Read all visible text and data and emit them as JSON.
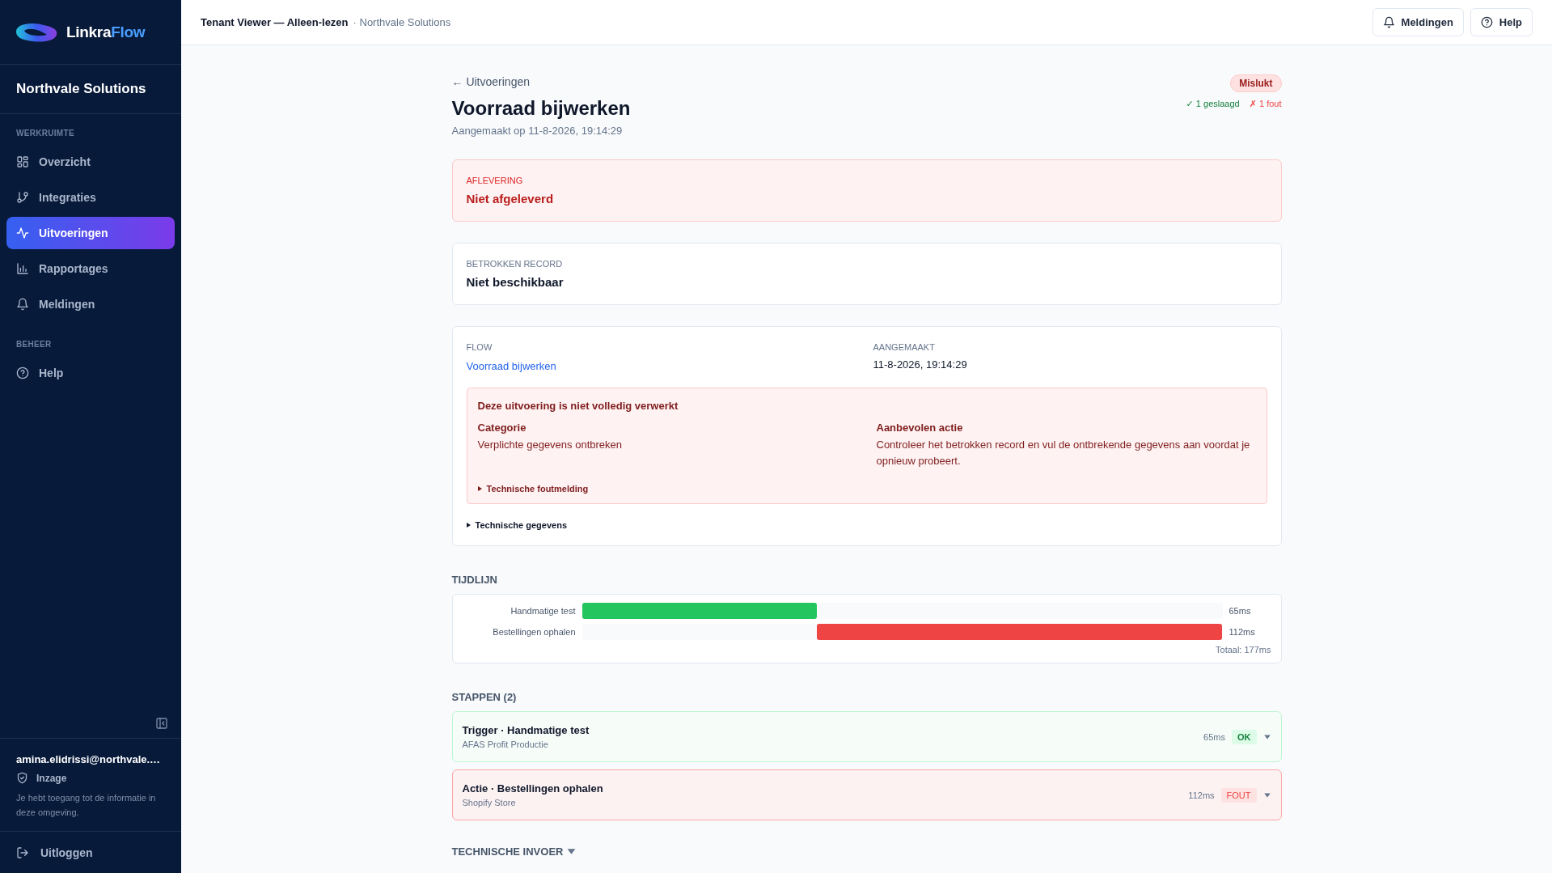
{
  "sidebar": {
    "logo": {
      "part1": "Linkra",
      "part2": "Flow"
    },
    "tenant": "Northvale Solutions",
    "sections": [
      {
        "title": "WERKRUIMTE",
        "items": [
          {
            "label": "Overzicht",
            "selected": false
          },
          {
            "label": "Integraties",
            "selected": false
          },
          {
            "label": "Uitvoeringen",
            "selected": true
          },
          {
            "label": "Rapportages",
            "selected": false
          },
          {
            "label": "Meldingen",
            "selected": false
          }
        ]
      },
      {
        "title": "BEHEER",
        "items": [
          {
            "label": "Help",
            "selected": false
          }
        ]
      }
    ],
    "user": {
      "email": "amina.elidrissi@northvale.…",
      "role": "Inzage",
      "description": "Je hebt toegang tot de informatie in deze omgeving."
    },
    "logout": "Uitloggen"
  },
  "topbar": {
    "title": "Tenant Viewer — Alleen-lezen",
    "subtitle": "· Northvale Solutions",
    "buttons": [
      "Meldingen",
      "Help"
    ]
  },
  "header": {
    "back": "← Uitvoeringen",
    "title": "Voorraad bijwerken",
    "created": "Aangemaakt op 11-8-2026, 19:14:29",
    "status": "Mislukt",
    "succeeded": "✓ 1 geslaagd",
    "failed": "✗ 1 fout"
  },
  "delivery": {
    "label": "AFLEVERING",
    "value": "Niet afgeleverd"
  },
  "record": {
    "label": "BETROKKEN RECORD",
    "value": "Niet beschikbaar"
  },
  "details": {
    "flow_label": "FLOW",
    "flow": "Voorraad bijwerken",
    "created_label": "AANGEMAAKT",
    "created": "11-8-2026, 19:14:29",
    "error": {
      "title": "Deze uitvoering is niet volledig verwerkt",
      "category_label": "Categorie",
      "category": "Verplichte gegevens ontbreken",
      "action_label": "Aanbevolen actie",
      "action": "Controleer het betrokken record en vul de ontbrekende gegevens aan voordat je opnieuw probeert.",
      "toggle": {
        "label": "Technische foutmelding",
        "expanded": false
      }
    },
    "toggle": {
      "label": "Technische gegevens",
      "expanded": false
    }
  },
  "timeline": {
    "title": "TIJDLIJN",
    "rows": [
      {
        "label": "Handmatige test",
        "level": 0.367,
        "duration": "65ms",
        "kind": "ok"
      },
      {
        "label": "Bestellingen ophalen",
        "level": 0.633,
        "duration": "112ms",
        "kind": "error"
      }
    ],
    "total": "Totaal: 177ms"
  },
  "steps": {
    "title": "STAPPEN (2)",
    "items": [
      {
        "title": "Trigger · Handmatige test",
        "subtitle": "AFAS Profit Productie",
        "duration": "65ms",
        "kind": "ok",
        "badge": "OK",
        "expanded": false
      },
      {
        "title": "Actie · Bestellingen ophalen",
        "subtitle": "Shopify Store",
        "duration": "112ms",
        "kind": "error",
        "badge": "FOUT",
        "expanded": false
      }
    ]
  },
  "technical_input": {
    "label": "TECHNISCHE INVOER",
    "expanded": false
  }
}
